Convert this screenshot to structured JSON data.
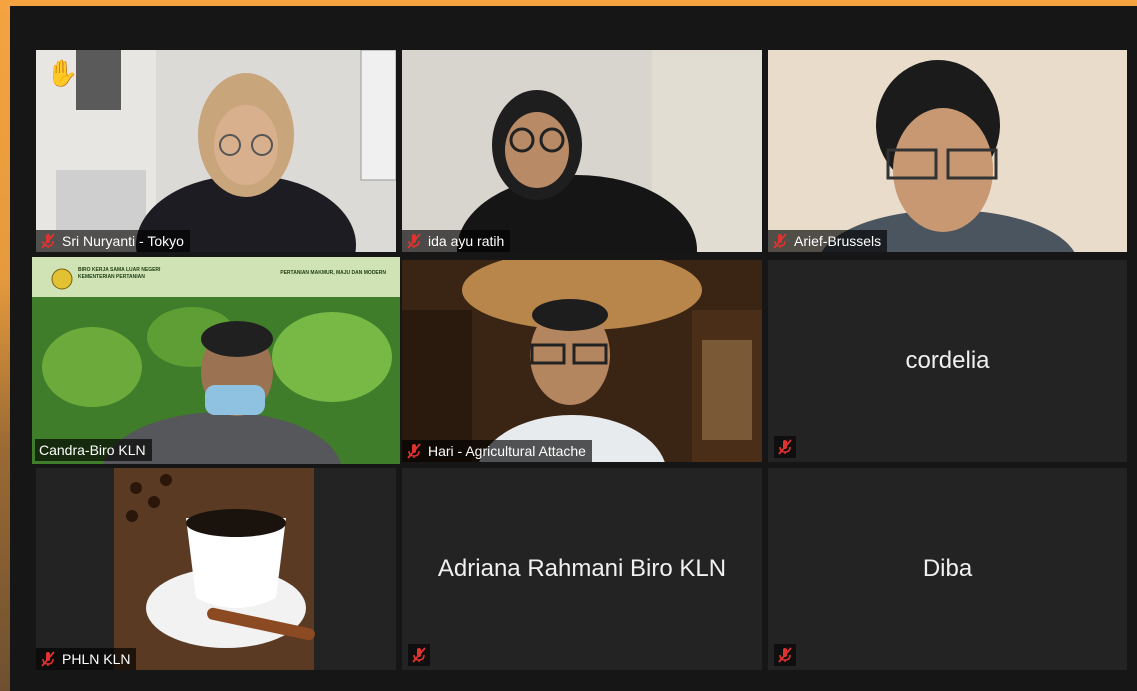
{
  "participants": [
    {
      "name": "Sri Nuryanti - Tokyo",
      "muted": true,
      "hand_raised": true
    },
    {
      "name": "ida ayu ratih",
      "muted": true
    },
    {
      "name": "Arief-Brussels",
      "muted": true
    },
    {
      "name": "Candra-Biro KLN",
      "muted": false,
      "active_speaker": true,
      "video_overlay_title": "BIRO KERJA SAMA LUAR NEGERI\nKEMENTERIAN PERTANIAN",
      "video_overlay_right": "PERTANIAN MAKMUR, MAJU DAN MODERN"
    },
    {
      "name": "Hari - Agricultural Attache",
      "muted": true
    },
    {
      "name": "cordelia",
      "muted": true,
      "video_off": true
    },
    {
      "name": "PHLN KLN",
      "muted": true
    },
    {
      "name": "Adriana Rahmani Biro KLN",
      "muted": true,
      "video_off": true
    },
    {
      "name": "Diba",
      "muted": true,
      "video_off": true
    }
  ],
  "colors": {
    "active_border": "#e7e46a",
    "muted_red": "#e0332f",
    "tile_bg": "#232323"
  },
  "icons": {
    "muted": "microphone-muted-icon",
    "hand": "raised-hand-icon"
  }
}
